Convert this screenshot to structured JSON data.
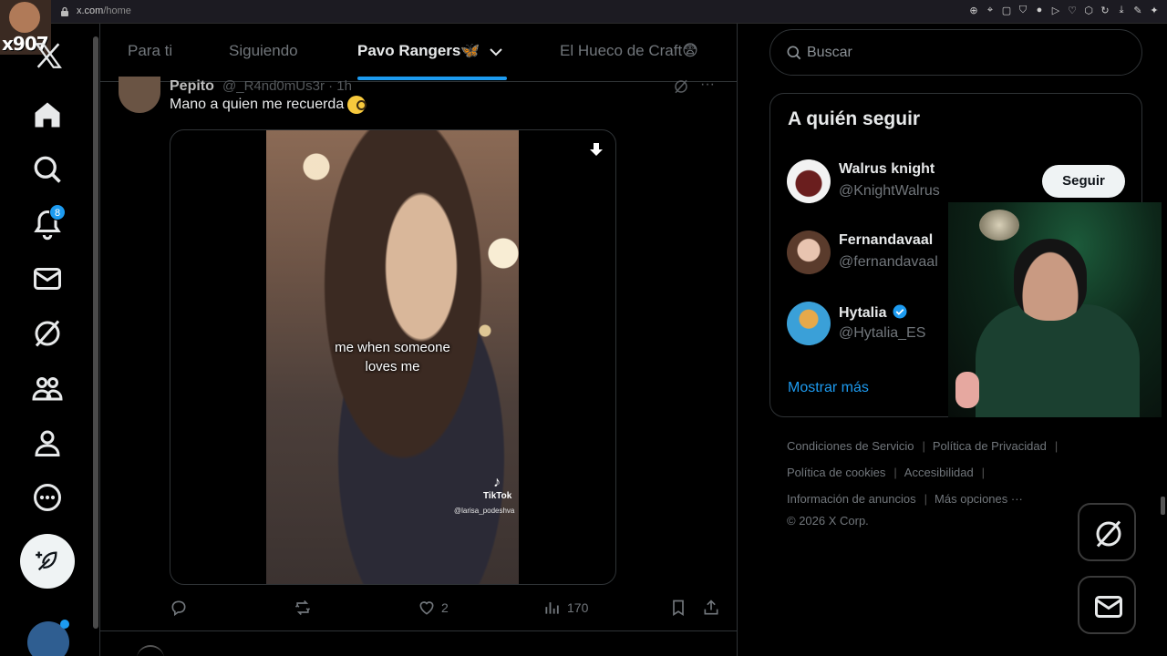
{
  "browser": {
    "url_host": "x.com",
    "url_path": "/home"
  },
  "overlay": {
    "streamer_tag": "x907"
  },
  "nav": {
    "notifications_count": "8",
    "items": [
      "home-icon",
      "search-icon",
      "bell-icon",
      "mail-icon",
      "grok-icon",
      "communities-icon",
      "profile-icon",
      "more-icon"
    ]
  },
  "tabs": [
    {
      "label": "Para ti"
    },
    {
      "label": "Siguiendo"
    },
    {
      "label": "Pavo Rangers🦋"
    },
    {
      "label": "El Hueco de Craft😨"
    }
  ],
  "post": {
    "author": "Pepito",
    "handle": "@_R4nd0mUs3r · 1h",
    "text": "Mano a quien me recuerda",
    "video_caption_line1": "me when someone",
    "video_caption_line2": "loves me",
    "tiktok_label": "TikTok",
    "tiktok_user": "@larisa_podeshva",
    "likes": "2",
    "views": "170"
  },
  "search": {
    "placeholder": "Buscar"
  },
  "who_to_follow": {
    "title": "A quién seguir",
    "follow_label": "Seguir",
    "accounts": [
      {
        "name": "Walrus knight",
        "handle": "@KnightWalrus"
      },
      {
        "name": "Fernandavaal",
        "handle": "@fernandavaal"
      },
      {
        "name": "Hytalia",
        "handle": "@Hytalia_ES",
        "verified": true
      }
    ],
    "show_more": "Mostrar más"
  },
  "footer": {
    "terms": "Condiciones de Servicio",
    "privacy": "Política de Privacidad",
    "cookies": "Política de cookies",
    "accessibility": "Accesibilidad",
    "ads_info": "Información de anuncios",
    "more_options": "Más opciones ···",
    "copyright": "© 2026 X Corp."
  },
  "colors": {
    "accent": "#1d9bf0",
    "background": "#000000",
    "muted": "#71767b",
    "text": "#e7e9ea"
  }
}
